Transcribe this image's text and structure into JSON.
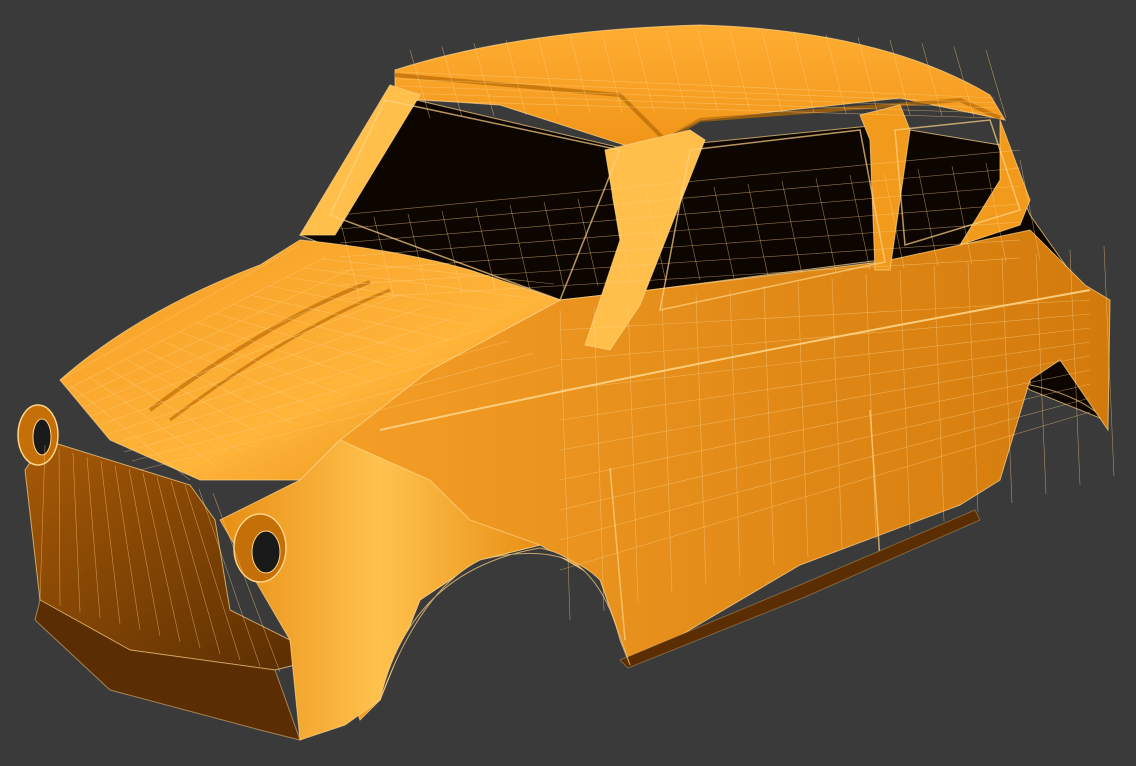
{
  "viewport": {
    "background": "#3a3a3a",
    "render_mode": "shaded-wireframe",
    "subject": "car-body-shell"
  },
  "colors": {
    "body": "#f29a1c",
    "body_light": "#ffbf4a",
    "body_dark": "#c46f08",
    "interior": "#0d0600",
    "wire": "#ffd486",
    "shadow": "#5a2e02"
  }
}
